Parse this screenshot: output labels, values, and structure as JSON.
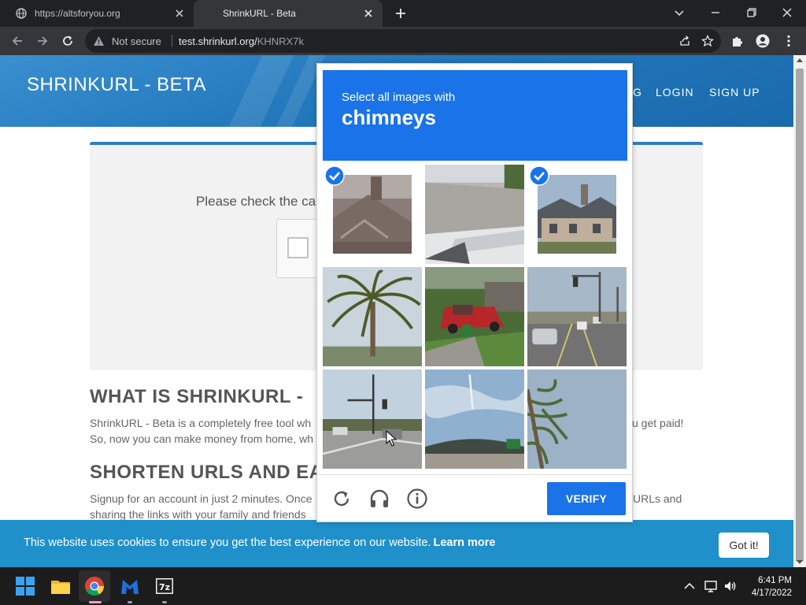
{
  "browser": {
    "tabs": [
      {
        "label": "https://altsforyou.org",
        "active": false
      },
      {
        "label": "ShrinkURL - Beta",
        "active": true
      }
    ],
    "security_label": "Not secure",
    "url_host": "test.shrinkurl.org/",
    "url_path": "KHNRX7k"
  },
  "site": {
    "logo": "SHRINKURL - BETA",
    "nav_partial": "G",
    "nav": [
      "LOGIN",
      "SIGN UP"
    ],
    "card_text": "Please check the ca",
    "section1_title": "WHAT IS SHRINKURL -",
    "section1_text_line1": "ShrinkURL - Beta is a completely free tool wh",
    "section1_text_right": "u get paid!",
    "section1_text_line2": "So, now you can make money from home, wh",
    "section2_title": "SHORTEN URLS AND EA",
    "section2_text_line1": "Signup for an account in just 2 minutes. Once",
    "section2_text_right": "URLs and",
    "section2_text_line2": "sharing the links with your family and friends",
    "cookie_text": "This website uses cookies to ensure you get the best experience on our website.",
    "cookie_link": "Learn more",
    "cookie_button": "Got it!"
  },
  "captcha": {
    "instruction": "Select all images with",
    "target": "chimneys",
    "verify_label": "VERIFY",
    "tiles": [
      {
        "selected": true
      },
      {
        "selected": false
      },
      {
        "selected": true
      },
      {
        "selected": false
      },
      {
        "selected": false
      },
      {
        "selected": false
      },
      {
        "selected": false
      },
      {
        "selected": false
      },
      {
        "selected": false
      }
    ]
  },
  "taskbar": {
    "time": "6:41 PM",
    "date": "4/17/2022"
  },
  "colors": {
    "captcha_blue": "#1a73e8",
    "header_blue": "#2278bb",
    "cookie_blue": "#1f90c9"
  }
}
